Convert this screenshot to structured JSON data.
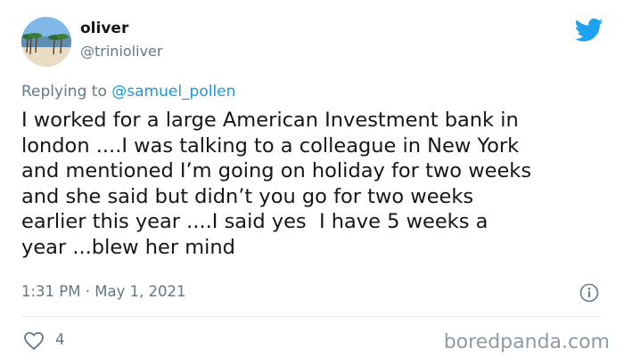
{
  "user": {
    "name": "oliver",
    "handle": "@trinioliver"
  },
  "reply": {
    "prefix": "Replying to",
    "mention": "@samuel_pollen"
  },
  "tweet": {
    "text": "I worked for a large American Investment bank in\nlondon ....I was talking to a colleague in New York\nand mentioned I’m going on holiday for two weeks\nand she said but didn’t you go for two weeks\nearlier this year ....I said yes  I have 5 weeks a\nyear ...blew her mind",
    "timestamp": "1:31 PM · May 1, 2021",
    "likes": "4"
  },
  "icons": {
    "avatar": "avatar",
    "bird": "twitter-bird-icon",
    "info": "info-icon",
    "like": "heart-icon"
  },
  "colors": {
    "brand": "#1da1f2",
    "secondary_text": "#657786",
    "primary_text": "#14171a",
    "mention": "#1b95e0"
  },
  "watermark": "boredpanda.com"
}
